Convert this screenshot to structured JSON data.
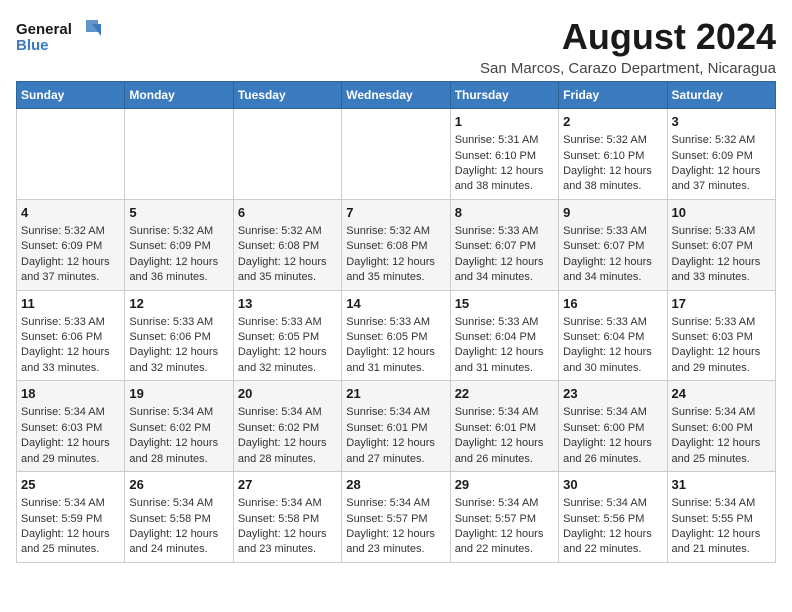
{
  "logo": {
    "line1": "General",
    "line2": "Blue"
  },
  "title": "August 2024",
  "subtitle": "San Marcos, Carazo Department, Nicaragua",
  "days_of_week": [
    "Sunday",
    "Monday",
    "Tuesday",
    "Wednesday",
    "Thursday",
    "Friday",
    "Saturday"
  ],
  "weeks": [
    [
      {
        "day": "",
        "content": ""
      },
      {
        "day": "",
        "content": ""
      },
      {
        "day": "",
        "content": ""
      },
      {
        "day": "",
        "content": ""
      },
      {
        "day": "1",
        "content": "Sunrise: 5:31 AM\nSunset: 6:10 PM\nDaylight: 12 hours\nand 38 minutes."
      },
      {
        "day": "2",
        "content": "Sunrise: 5:32 AM\nSunset: 6:10 PM\nDaylight: 12 hours\nand 38 minutes."
      },
      {
        "day": "3",
        "content": "Sunrise: 5:32 AM\nSunset: 6:09 PM\nDaylight: 12 hours\nand 37 minutes."
      }
    ],
    [
      {
        "day": "4",
        "content": "Sunrise: 5:32 AM\nSunset: 6:09 PM\nDaylight: 12 hours\nand 37 minutes."
      },
      {
        "day": "5",
        "content": "Sunrise: 5:32 AM\nSunset: 6:09 PM\nDaylight: 12 hours\nand 36 minutes."
      },
      {
        "day": "6",
        "content": "Sunrise: 5:32 AM\nSunset: 6:08 PM\nDaylight: 12 hours\nand 35 minutes."
      },
      {
        "day": "7",
        "content": "Sunrise: 5:32 AM\nSunset: 6:08 PM\nDaylight: 12 hours\nand 35 minutes."
      },
      {
        "day": "8",
        "content": "Sunrise: 5:33 AM\nSunset: 6:07 PM\nDaylight: 12 hours\nand 34 minutes."
      },
      {
        "day": "9",
        "content": "Sunrise: 5:33 AM\nSunset: 6:07 PM\nDaylight: 12 hours\nand 34 minutes."
      },
      {
        "day": "10",
        "content": "Sunrise: 5:33 AM\nSunset: 6:07 PM\nDaylight: 12 hours\nand 33 minutes."
      }
    ],
    [
      {
        "day": "11",
        "content": "Sunrise: 5:33 AM\nSunset: 6:06 PM\nDaylight: 12 hours\nand 33 minutes."
      },
      {
        "day": "12",
        "content": "Sunrise: 5:33 AM\nSunset: 6:06 PM\nDaylight: 12 hours\nand 32 minutes."
      },
      {
        "day": "13",
        "content": "Sunrise: 5:33 AM\nSunset: 6:05 PM\nDaylight: 12 hours\nand 32 minutes."
      },
      {
        "day": "14",
        "content": "Sunrise: 5:33 AM\nSunset: 6:05 PM\nDaylight: 12 hours\nand 31 minutes."
      },
      {
        "day": "15",
        "content": "Sunrise: 5:33 AM\nSunset: 6:04 PM\nDaylight: 12 hours\nand 31 minutes."
      },
      {
        "day": "16",
        "content": "Sunrise: 5:33 AM\nSunset: 6:04 PM\nDaylight: 12 hours\nand 30 minutes."
      },
      {
        "day": "17",
        "content": "Sunrise: 5:33 AM\nSunset: 6:03 PM\nDaylight: 12 hours\nand 29 minutes."
      }
    ],
    [
      {
        "day": "18",
        "content": "Sunrise: 5:34 AM\nSunset: 6:03 PM\nDaylight: 12 hours\nand 29 minutes."
      },
      {
        "day": "19",
        "content": "Sunrise: 5:34 AM\nSunset: 6:02 PM\nDaylight: 12 hours\nand 28 minutes."
      },
      {
        "day": "20",
        "content": "Sunrise: 5:34 AM\nSunset: 6:02 PM\nDaylight: 12 hours\nand 28 minutes."
      },
      {
        "day": "21",
        "content": "Sunrise: 5:34 AM\nSunset: 6:01 PM\nDaylight: 12 hours\nand 27 minutes."
      },
      {
        "day": "22",
        "content": "Sunrise: 5:34 AM\nSunset: 6:01 PM\nDaylight: 12 hours\nand 26 minutes."
      },
      {
        "day": "23",
        "content": "Sunrise: 5:34 AM\nSunset: 6:00 PM\nDaylight: 12 hours\nand 26 minutes."
      },
      {
        "day": "24",
        "content": "Sunrise: 5:34 AM\nSunset: 6:00 PM\nDaylight: 12 hours\nand 25 minutes."
      }
    ],
    [
      {
        "day": "25",
        "content": "Sunrise: 5:34 AM\nSunset: 5:59 PM\nDaylight: 12 hours\nand 25 minutes."
      },
      {
        "day": "26",
        "content": "Sunrise: 5:34 AM\nSunset: 5:58 PM\nDaylight: 12 hours\nand 24 minutes."
      },
      {
        "day": "27",
        "content": "Sunrise: 5:34 AM\nSunset: 5:58 PM\nDaylight: 12 hours\nand 23 minutes."
      },
      {
        "day": "28",
        "content": "Sunrise: 5:34 AM\nSunset: 5:57 PM\nDaylight: 12 hours\nand 23 minutes."
      },
      {
        "day": "29",
        "content": "Sunrise: 5:34 AM\nSunset: 5:57 PM\nDaylight: 12 hours\nand 22 minutes."
      },
      {
        "day": "30",
        "content": "Sunrise: 5:34 AM\nSunset: 5:56 PM\nDaylight: 12 hours\nand 22 minutes."
      },
      {
        "day": "31",
        "content": "Sunrise: 5:34 AM\nSunset: 5:55 PM\nDaylight: 12 hours\nand 21 minutes."
      }
    ]
  ]
}
